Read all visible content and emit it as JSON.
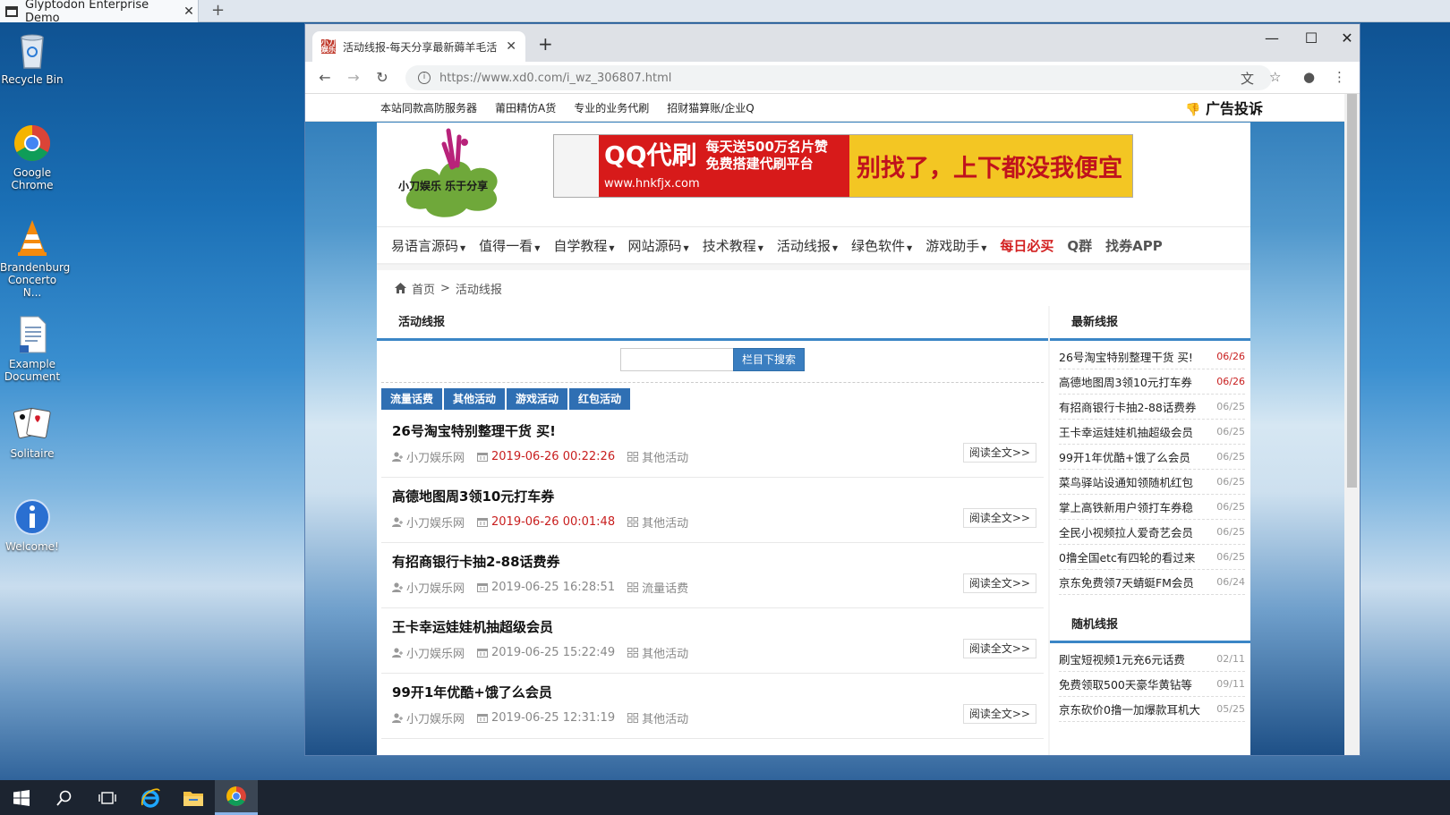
{
  "vm": {
    "tab_title": "Glyptodon Enterprise Demo",
    "close": "✕",
    "plus": "+"
  },
  "desktop": [
    {
      "name": "recycle-bin",
      "label": "Recycle Bin"
    },
    {
      "name": "google-chrome",
      "label": "Google Chrome"
    },
    {
      "name": "vlc",
      "label": "Brandenburg Concerto N..."
    },
    {
      "name": "example-document",
      "label": "Example Document"
    },
    {
      "name": "solitaire",
      "label": "Solitaire"
    },
    {
      "name": "welcome",
      "label": "Welcome!"
    }
  ],
  "browser": {
    "tab_title": "活动线报-每天分享最新薅羊毛活",
    "favicon_text": "小刀娱乐",
    "url": "https://www.xd0.com/i_wz_306807.html"
  },
  "page": {
    "top_links": [
      "本站同款高防服务器",
      "莆田精仿A货",
      "专业的业务代刷",
      "招财猫算账/企业Q"
    ],
    "ad_complaint": "广告投诉",
    "logo_text": "小刀娱乐 乐于分享",
    "banner": {
      "left_line1": "QQ代刷",
      "left_line2": "每天送500万名片赞",
      "left_line3": "免费搭建代刷平台",
      "url": "www.hnkfjx.com",
      "right": "别找了，上下都没我便宜"
    },
    "nav": [
      {
        "label": "易语言源码",
        "dropdown": true,
        "style": ""
      },
      {
        "label": "值得一看",
        "dropdown": true,
        "style": ""
      },
      {
        "label": "自学教程",
        "dropdown": true,
        "style": ""
      },
      {
        "label": "网站源码",
        "dropdown": true,
        "style": ""
      },
      {
        "label": "技术教程",
        "dropdown": true,
        "style": ""
      },
      {
        "label": "活动线报",
        "dropdown": true,
        "style": ""
      },
      {
        "label": "绿色软件",
        "dropdown": true,
        "style": ""
      },
      {
        "label": "游戏助手",
        "dropdown": true,
        "style": ""
      },
      {
        "label": "每日必买",
        "dropdown": false,
        "style": "red"
      },
      {
        "label": "Q群",
        "dropdown": false,
        "style": "grey"
      },
      {
        "label": "找券APP",
        "dropdown": false,
        "style": "grey"
      }
    ],
    "breadcrumb": {
      "home": "首页",
      "sep": ">",
      "current": "活动线报"
    },
    "main_title": "活动线报",
    "search_button": "栏目下搜索",
    "categories": [
      "流量话费",
      "其他活动",
      "游戏活动",
      "红包活动"
    ],
    "read_more": "阅读全文>>",
    "articles": [
      {
        "title": "26号淘宝特别整理干货 买!",
        "author": "小刀娱乐网",
        "date": "2019-06-26 00:22:26",
        "date_red": true,
        "category": "其他活动"
      },
      {
        "title": "高德地图周3领10元打车券",
        "author": "小刀娱乐网",
        "date": "2019-06-26 00:01:48",
        "date_red": true,
        "category": "其他活动"
      },
      {
        "title": "有招商银行卡抽2-88话费券",
        "author": "小刀娱乐网",
        "date": "2019-06-25 16:28:51",
        "date_red": false,
        "category": "流量话费"
      },
      {
        "title": "王卡幸运娃娃机抽超级会员",
        "author": "小刀娱乐网",
        "date": "2019-06-25 15:22:49",
        "date_red": false,
        "category": "其他活动"
      },
      {
        "title": "99开1年优酷+饿了么会员",
        "author": "小刀娱乐网",
        "date": "2019-06-25 12:31:19",
        "date_red": false,
        "category": "其他活动"
      }
    ],
    "latest_title": "最新线报",
    "latest": [
      {
        "t": "26号淘宝特别整理干货 买!",
        "d": "06/26",
        "red": true
      },
      {
        "t": "高德地图周3领10元打车券",
        "d": "06/26",
        "red": true
      },
      {
        "t": "有招商银行卡抽2-88话费券",
        "d": "06/25",
        "red": false
      },
      {
        "t": "王卡幸运娃娃机抽超级会员",
        "d": "06/25",
        "red": false
      },
      {
        "t": "99开1年优酷+饿了么会员",
        "d": "06/25",
        "red": false
      },
      {
        "t": "菜鸟驿站设通知领随机红包",
        "d": "06/25",
        "red": false
      },
      {
        "t": "掌上高铁新用户领打车券稳",
        "d": "06/25",
        "red": false
      },
      {
        "t": "全民小视频拉人爱奇艺会员",
        "d": "06/25",
        "red": false
      },
      {
        "t": "0撸全国etc有四轮的看过来",
        "d": "06/25",
        "red": false
      },
      {
        "t": "京东免费领7天蜻蜓FM会员",
        "d": "06/24",
        "red": false
      }
    ],
    "random_title": "随机线报",
    "random": [
      {
        "t": "刷宝短视频1元充6元话费",
        "d": "02/11"
      },
      {
        "t": "免费领取500天豪华黄钻等",
        "d": "09/11"
      },
      {
        "t": "京东砍价0撸一加爆款耳机大",
        "d": "05/25"
      }
    ]
  }
}
